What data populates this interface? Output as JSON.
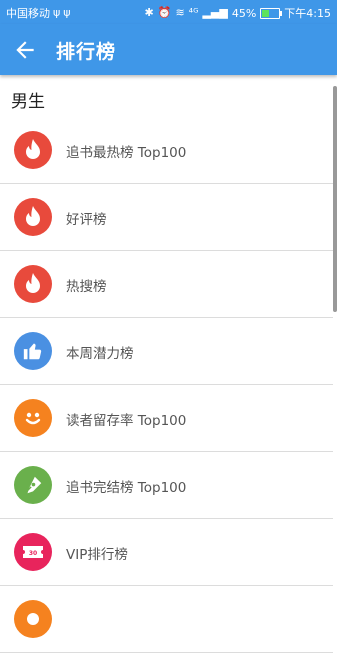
{
  "status": {
    "carrier": "中国移动",
    "battery": "45%",
    "battery_level": 0.45,
    "time": "下午4:15",
    "net": "⁴ᴳ"
  },
  "appbar": {
    "title": "排行榜"
  },
  "section_title": "男生",
  "items": [
    {
      "label": "追书最热榜 Top100",
      "icon": "flame-icon",
      "color": "#e84a3c"
    },
    {
      "label": "好评榜",
      "icon": "flame-icon",
      "color": "#e84a3c"
    },
    {
      "label": "热搜榜",
      "icon": "flame-icon",
      "color": "#e84a3c"
    },
    {
      "label": "本周潜力榜",
      "icon": "thumbs-up-icon",
      "color": "#4a90e2"
    },
    {
      "label": "读者留存率 Top100",
      "icon": "smiley-icon",
      "color": "#f5821f"
    },
    {
      "label": "追书完结榜 Top100",
      "icon": "pen-icon",
      "color": "#6ab04c"
    },
    {
      "label": "VIP排行榜",
      "icon": "ticket-icon",
      "color": "#e8245c"
    },
    {
      "label": "",
      "icon": "badge-icon",
      "color": "#f5821f"
    }
  ]
}
